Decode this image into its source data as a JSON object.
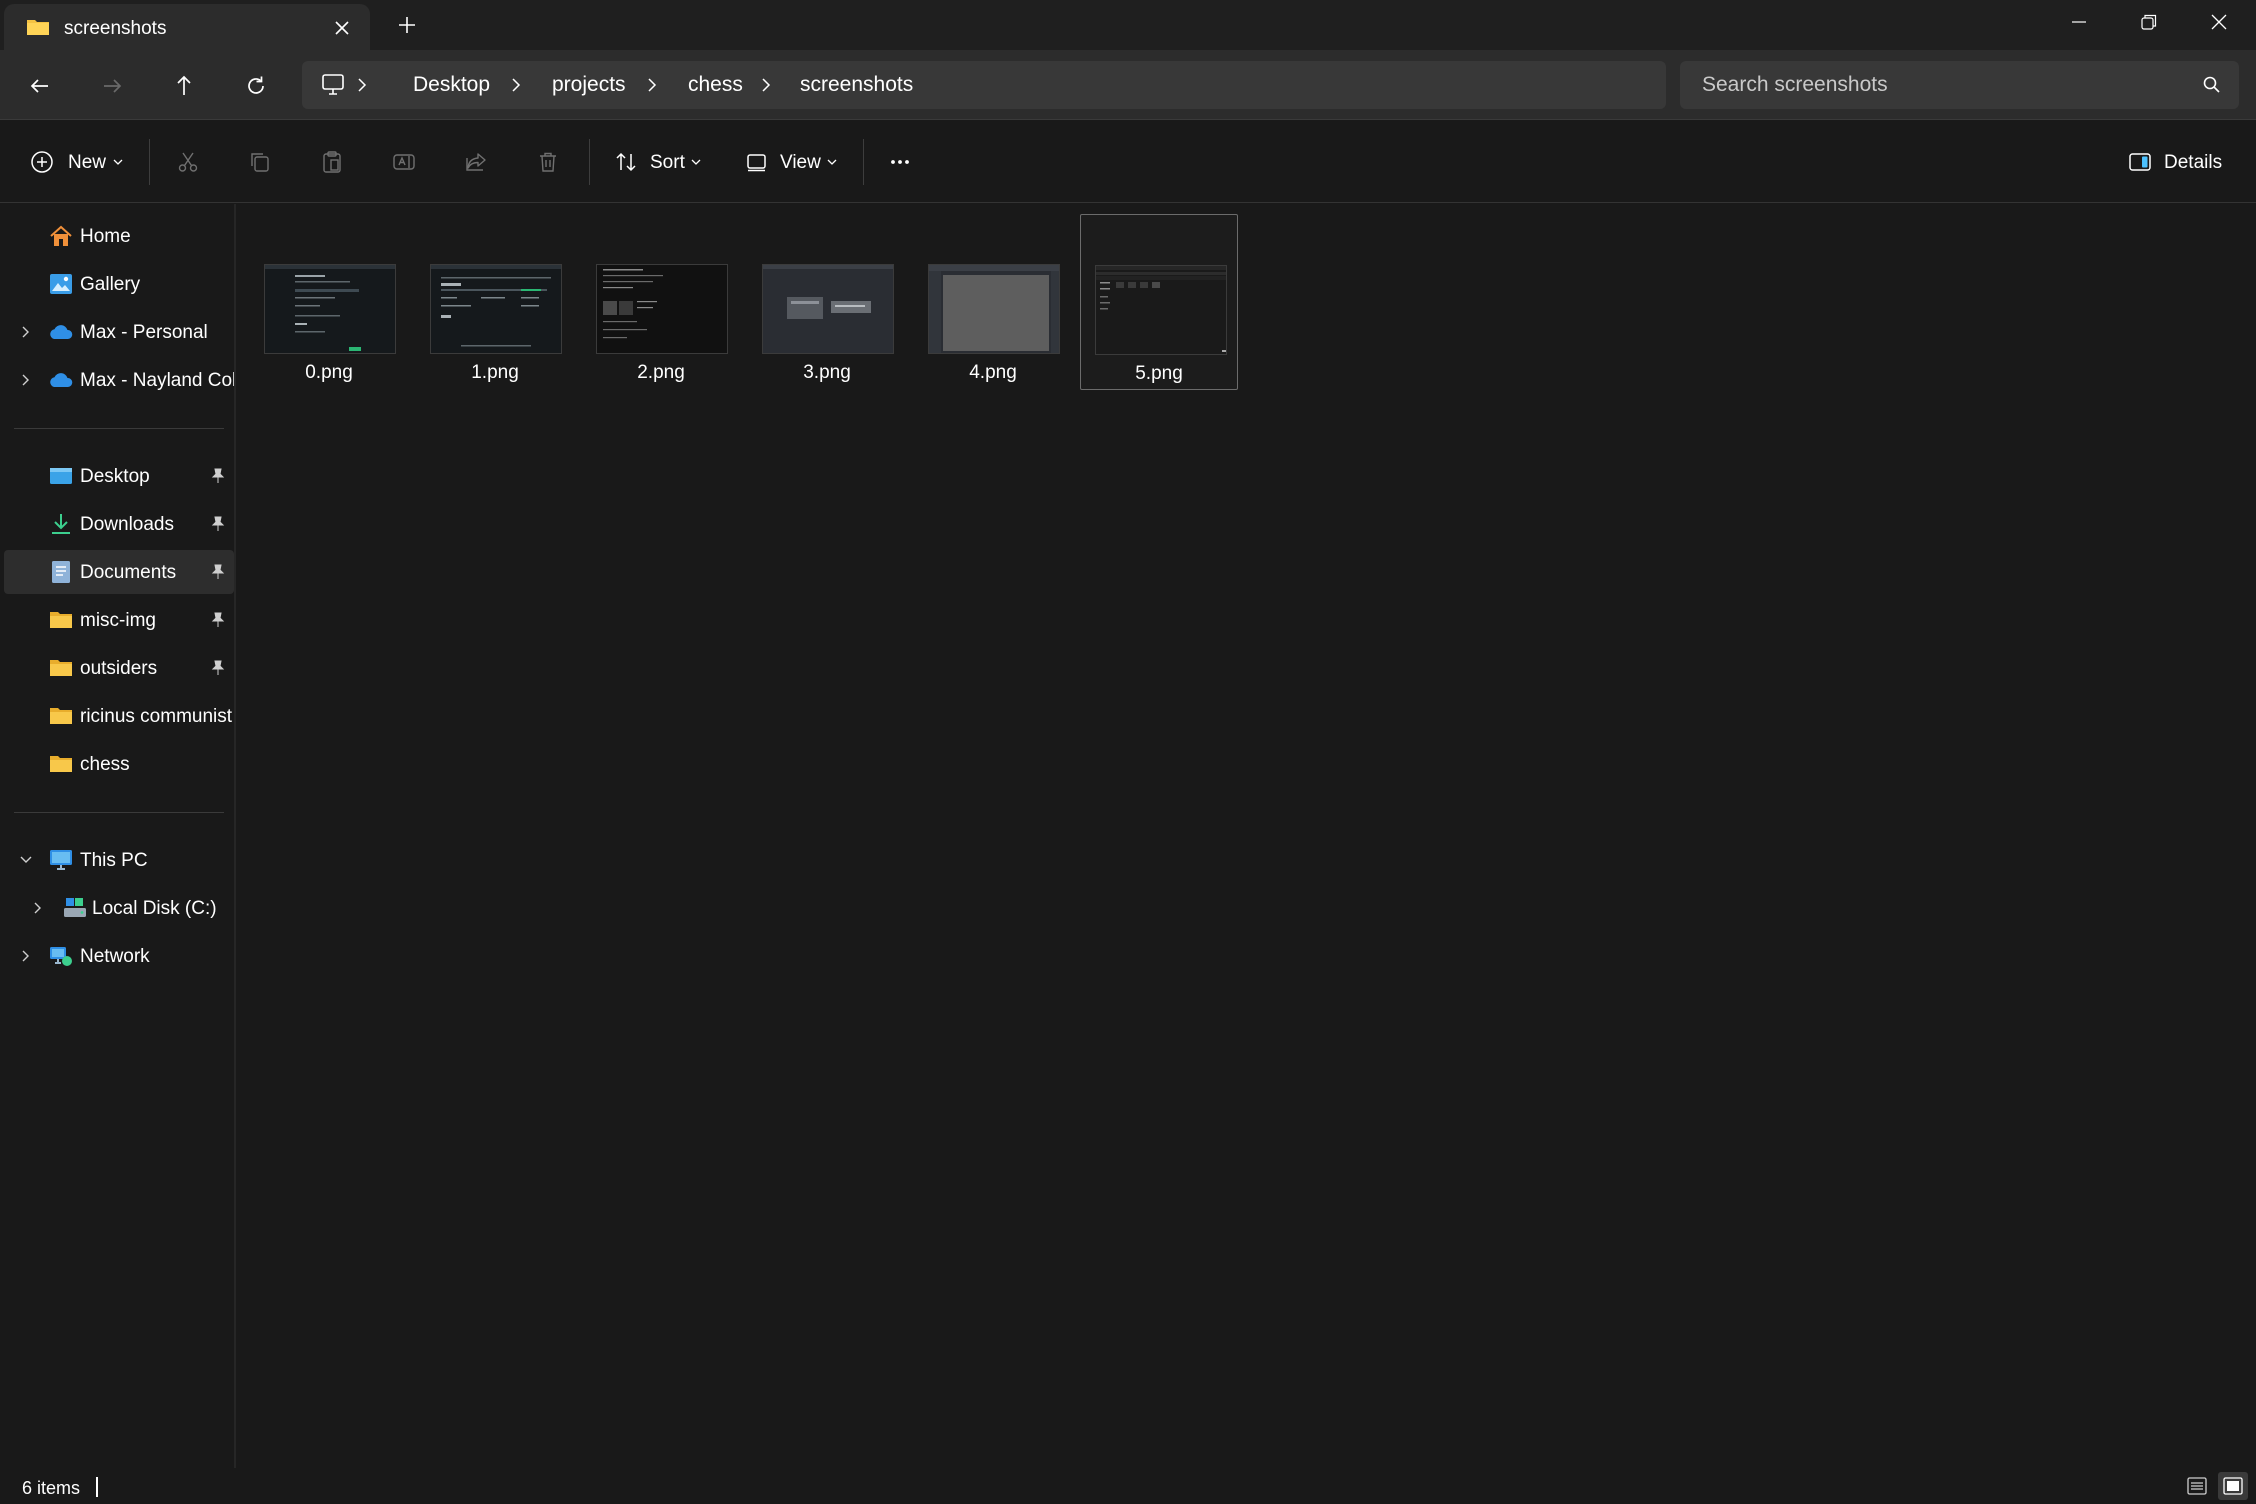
{
  "window": {
    "tab_title": "screenshots",
    "icons": {
      "tab": "folder-icon",
      "close_tab": "close-icon",
      "new_tab": "plus-icon",
      "minimize": "minimize-icon",
      "restore": "restore-icon",
      "close": "close-icon"
    }
  },
  "nav": {
    "icons": {
      "back": "arrow-left-icon",
      "forward": "arrow-right-icon",
      "up": "arrow-up-icon",
      "refresh": "refresh-icon"
    }
  },
  "breadcrumb": [
    "Desktop",
    "projects",
    "chess",
    "screenshots"
  ],
  "search": {
    "placeholder": "Search screenshots"
  },
  "toolbar": {
    "new_label": "New",
    "sort_label": "Sort",
    "view_label": "View",
    "details_label": "Details",
    "icons": [
      "cut-icon",
      "copy-icon",
      "paste-icon",
      "rename-icon",
      "share-icon",
      "delete-icon",
      "more-icon"
    ]
  },
  "sidebar": {
    "items": [
      {
        "label": "Home",
        "icon": "home-icon"
      },
      {
        "label": "Gallery",
        "icon": "gallery-icon"
      },
      {
        "label": "Max - Personal",
        "icon": "cloud-icon"
      },
      {
        "label": "Max - Nayland College",
        "icon": "cloud-icon"
      },
      {
        "label": "Desktop",
        "icon": "desktop-folder-icon"
      },
      {
        "label": "Downloads",
        "icon": "download-icon"
      },
      {
        "label": "Documents",
        "icon": "documents-icon"
      },
      {
        "label": "misc-img",
        "icon": "folder-icon"
      },
      {
        "label": "outsiders",
        "icon": "folder-icon"
      },
      {
        "label": "ricinus communist",
        "icon": "folder-icon"
      },
      {
        "label": "chess",
        "icon": "folder-icon"
      },
      {
        "label": "This PC",
        "icon": "pc-icon"
      },
      {
        "label": "Local Disk (C:)",
        "icon": "disk-icon"
      },
      {
        "label": "Network",
        "icon": "network-icon"
      }
    ],
    "selected": "Documents"
  },
  "files": [
    {
      "name": "0.png"
    },
    {
      "name": "1.png"
    },
    {
      "name": "2.png"
    },
    {
      "name": "3.png"
    },
    {
      "name": "4.png"
    },
    {
      "name": "5.png"
    }
  ],
  "selected_file": "5.png",
  "status": {
    "item_count": "6 items"
  },
  "colors": {
    "background": "#191919",
    "titlebar": "#1f1f1f",
    "navbar": "#2c2c2c",
    "field": "#383838",
    "folder": "#f4c243",
    "accent": "#4cc2ff"
  }
}
